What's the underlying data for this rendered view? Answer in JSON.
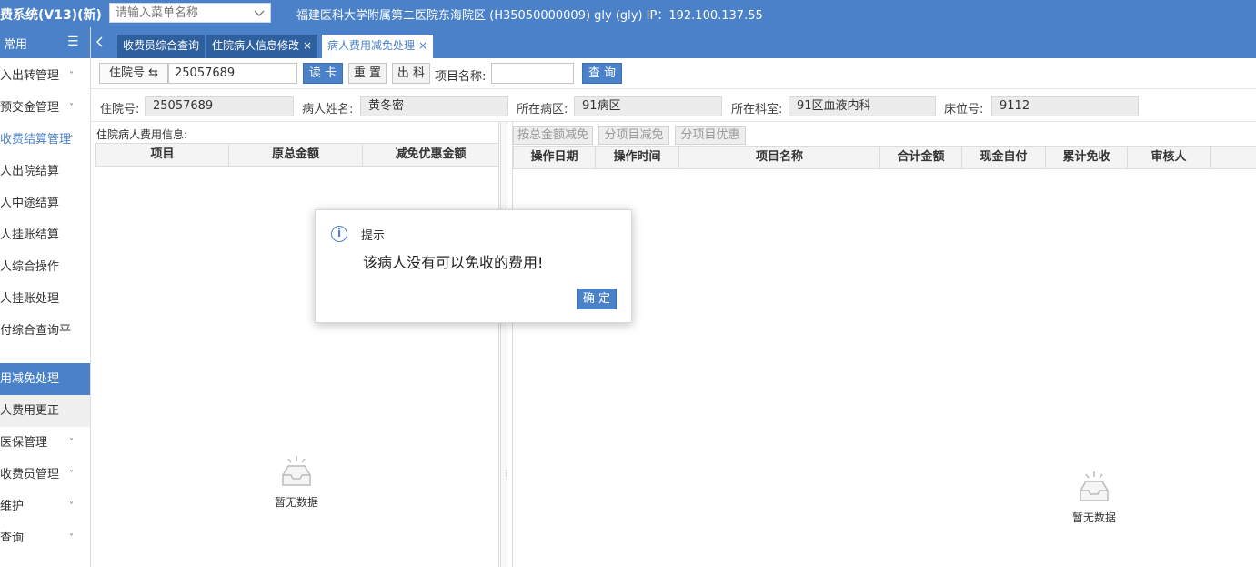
{
  "topbar": {
    "app_title": "费系统(V13)(新)",
    "menu_search_placeholder": "请输入菜单名称",
    "hospital_info": "福建医科大学附属第二医院东海院区 (H35050000009) gly (gly) IP：192.100.137.55"
  },
  "sidebar": {
    "header_label": "常用",
    "items": [
      {
        "label": "入出转管理",
        "chevron": "˅"
      },
      {
        "label": "预交金管理",
        "chevron": "˅"
      },
      {
        "label": "收费结算管理",
        "chevron": "˄"
      },
      {
        "label": "人出院结算"
      },
      {
        "label": "人中途结算"
      },
      {
        "label": "人挂账结算"
      },
      {
        "label": "人综合操作"
      },
      {
        "label": "人挂账处理"
      },
      {
        "label": "付综合查询平"
      },
      {
        "label": "用减免处理"
      },
      {
        "label": "人费用更正"
      },
      {
        "label": "医保管理",
        "chevron": "˅"
      },
      {
        "label": "收费员管理",
        "chevron": "˅"
      },
      {
        "label": "维护",
        "chevron": "˅"
      },
      {
        "label": "查询",
        "chevron": "˅"
      }
    ]
  },
  "tabs": [
    {
      "label": "收费员综合查询"
    },
    {
      "label": "住院病人信息修改",
      "close": "×"
    },
    {
      "label": "病人费用减免处理",
      "close": "×"
    }
  ],
  "toolbar": {
    "id_type": "住院号 ⇆",
    "id_value": "25057689",
    "read_card": "读 卡",
    "reset": "重 置",
    "discharge": "出 科",
    "item_name_label": "项目名称:",
    "item_name_value": "",
    "query": "查 询"
  },
  "patient": {
    "admission_no_label": "住院号:",
    "admission_no": "25057689",
    "name_label": "病人姓名:",
    "name": "黄冬密",
    "ward_label": "所在病区:",
    "ward": "91病区",
    "dept_label": "所在科室:",
    "dept": "91区血液内科",
    "bed_label": "床位号:",
    "bed": "9112"
  },
  "left_panel": {
    "title": "住院病人费用信息:",
    "columns": [
      "项目",
      "原总金额",
      "减免优惠金额"
    ],
    "empty_text": "暂无数据"
  },
  "right_panel": {
    "buttons": [
      "按总金额减免",
      "分项目减免",
      "分项目优惠"
    ],
    "columns": [
      "操作日期",
      "操作时间",
      "项目名称",
      "合计金额",
      "现金自付",
      "累计免收",
      "审核人"
    ],
    "empty_text": "暂无数据"
  },
  "dialog": {
    "title": "提示",
    "message": "该病人没有可以免收的费用!",
    "ok_label": "确 定"
  }
}
